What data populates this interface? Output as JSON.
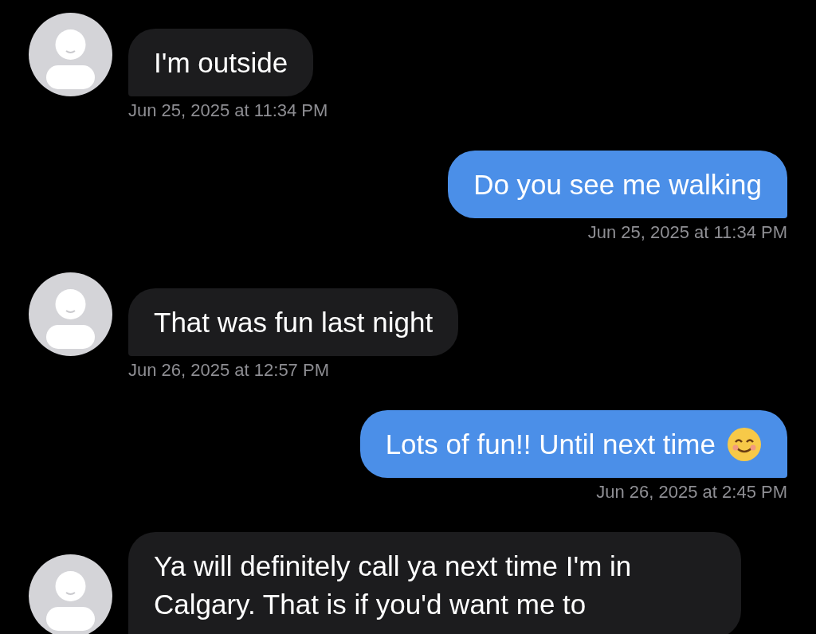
{
  "messages": [
    {
      "kind": "received",
      "text": "I'm outside",
      "time": "Jun 25, 2025 at 11:34 PM"
    },
    {
      "kind": "sent",
      "text": "Do you see me walking",
      "time": "Jun 25, 2025 at 11:34 PM"
    },
    {
      "kind": "received",
      "text": "That was fun last night",
      "time": "Jun 26, 2025 at 12:57 PM"
    },
    {
      "kind": "sent",
      "text": "Lots of fun!! Until next time",
      "emoji": true,
      "time": "Jun 26, 2025 at 2:45 PM"
    },
    {
      "kind": "received",
      "text": "Ya will definitely call ya next time I'm in Calgary. That is if you'd want me to"
    }
  ]
}
